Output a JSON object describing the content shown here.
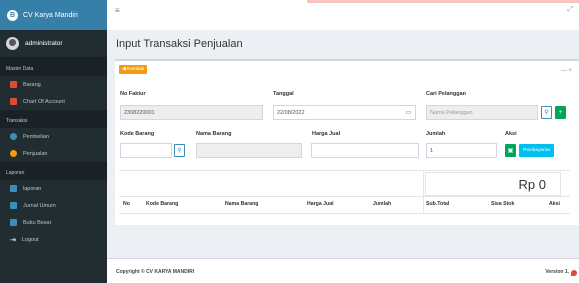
{
  "app": {
    "brand": "CV Karya Mandiri",
    "user": "administrator"
  },
  "sidebar": {
    "sections": [
      {
        "title": "Master Data",
        "items": [
          {
            "label": "Barang",
            "icon": "grid-icon"
          },
          {
            "label": "Chart Of Account",
            "icon": "grid-icon"
          }
        ]
      },
      {
        "title": "Transaksi",
        "items": [
          {
            "label": "Pembelian",
            "icon": "circle-icon"
          },
          {
            "label": "Penjualan",
            "icon": "circle-icon"
          }
        ]
      },
      {
        "title": "Laporan",
        "items": [
          {
            "label": "laporan",
            "icon": "file-icon"
          },
          {
            "label": "Jurnal Umum",
            "icon": "file-icon"
          },
          {
            "label": "Buku Besar",
            "icon": "file-icon"
          },
          {
            "label": "Logout",
            "icon": "logout-icon"
          }
        ]
      }
    ]
  },
  "topbar": {
    "menu_glyph": "≡",
    "expand_glyph": "⤢"
  },
  "page": {
    "title": "Input Transaksi Penjualan"
  },
  "form": {
    "back_label": "◀ Kembali",
    "tools": "—  ×",
    "no_faktur_label": "No Faktur",
    "no_faktur_value": "2308220001",
    "tanggal_label": "Tanggal",
    "tanggal_value": "22/08/2022",
    "cari_label": "Cari Pelanggan",
    "cari_placeholder": "Nama Pelanggan",
    "kode_barang_label": "Kode Barang",
    "nama_barang_label": "Nama Barang",
    "harga_jual_label": "Harga Jual",
    "jumlah_label": "Jumlah",
    "jumlah_value": "1",
    "aksi_label": "Aksi",
    "pay_label": "Pembayaran",
    "total": "Rp 0"
  },
  "table": {
    "headers": [
      "No",
      "Kode Barang",
      "Nama Barang",
      "Harga Jual",
      "Jumlah",
      "Sub.Total",
      "Sisa Stok",
      "Aksi"
    ]
  },
  "footer": {
    "copyright": "Copyright © CV KARYA MANDIRI",
    "version": "Version 1."
  }
}
